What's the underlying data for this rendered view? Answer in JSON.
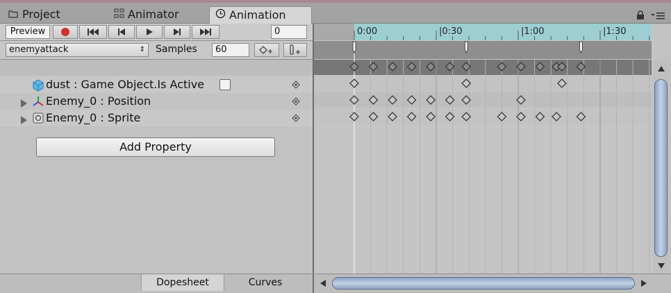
{
  "tabs": [
    {
      "label": "Project",
      "icon": "folder-icon"
    },
    {
      "label": "Animator",
      "icon": "animator-icon"
    },
    {
      "label": "Animation",
      "icon": "clock-icon",
      "active": true
    }
  ],
  "toolbar": {
    "preview_label": "Preview",
    "frame_value": "0",
    "record_color": "#d0302a"
  },
  "clip": {
    "selected": "enemyattack",
    "samples_label": "Samples",
    "samples_value": "60"
  },
  "properties": [
    {
      "label": "dust : Game Object.Is Active",
      "icon": "cube-icon",
      "expandable": false,
      "checkbox": false
    },
    {
      "label": "Enemy_0 : Position",
      "icon": "transform-axes-icon",
      "expandable": true
    },
    {
      "label": "Enemy_0 : Sprite",
      "icon": "sprite-renderer-icon",
      "expandable": true
    }
  ],
  "add_property_label": "Add Property",
  "timeline": {
    "ruler_labels": [
      "0:00",
      "|0:30",
      "|1:00",
      "|1:30"
    ],
    "events": [
      "0:00",
      "0:41",
      "1:23"
    ],
    "summary_keys": [
      "0:00",
      "0:07",
      "0:14",
      "0:21",
      "0:28",
      "0:35",
      "0:41",
      "0:54",
      "1:01",
      "1:08",
      "1:14",
      "1:16",
      "1:23"
    ],
    "rows": [
      [
        "0:00",
        "0:41",
        "1:16"
      ],
      [
        "0:00",
        "0:07",
        "0:14",
        "0:21",
        "0:28",
        "0:35",
        "0:41",
        "1:01"
      ],
      [
        "0:00",
        "0:07",
        "0:14",
        "0:21",
        "0:28",
        "0:35",
        "0:41",
        "0:54",
        "1:01",
        "1:08",
        "1:14",
        "1:23"
      ]
    ]
  },
  "bottom_tabs": [
    "Dopesheet",
    "Curves"
  ],
  "colors": {
    "ruler_teal": "#9dcfd2",
    "header_gray": "#a3a3a3"
  }
}
